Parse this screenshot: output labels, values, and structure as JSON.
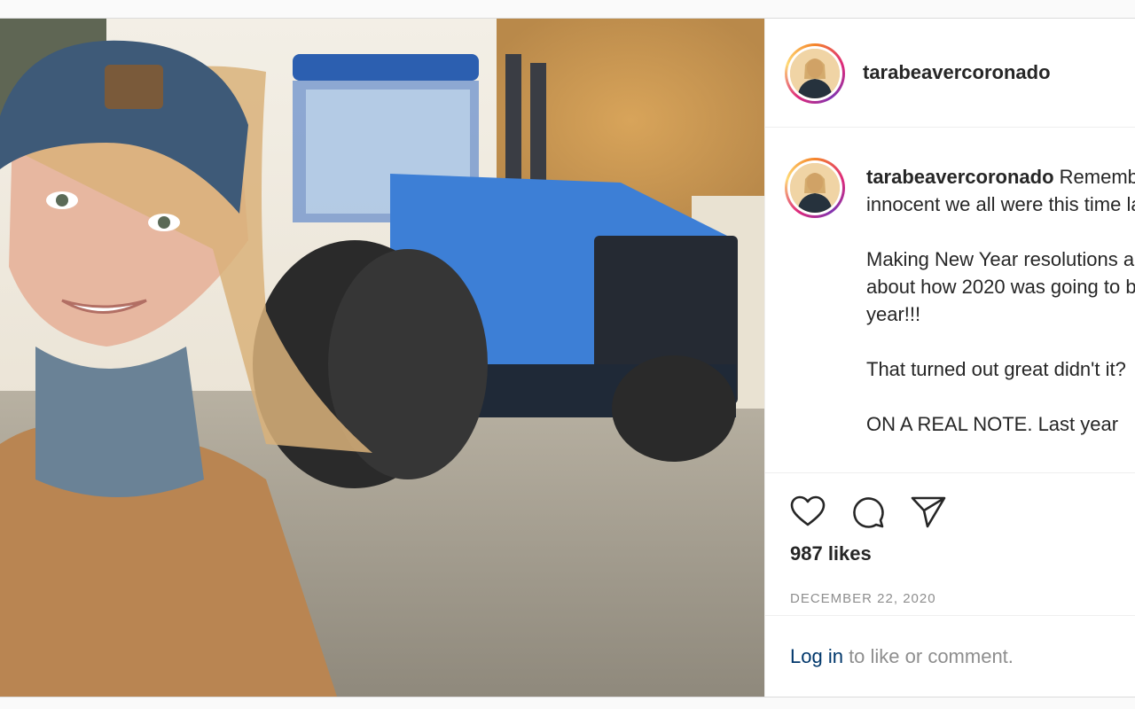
{
  "post": {
    "username": "tarabeavercoronado",
    "caption": {
      "text": " Remember how innocent we all were this time last year 😅\n\nMaking New Year resolutions and talking about how 2020 was going to be our year!!!\n\nThat turned out great didn't it?\n\nON A REAL NOTE. Last year"
    },
    "likes": "987 likes",
    "date": "DECEMBER 22, 2020",
    "login": {
      "link_label": "Log in",
      "suffix": " to like or comment."
    }
  },
  "icons": {
    "like": "heart-icon",
    "comment": "comment-icon",
    "share": "paper-plane-icon"
  },
  "colors": {
    "text": "#262626",
    "secondary_text": "#8e8e8e",
    "link": "#00376b",
    "border": "#dbdbdb"
  }
}
